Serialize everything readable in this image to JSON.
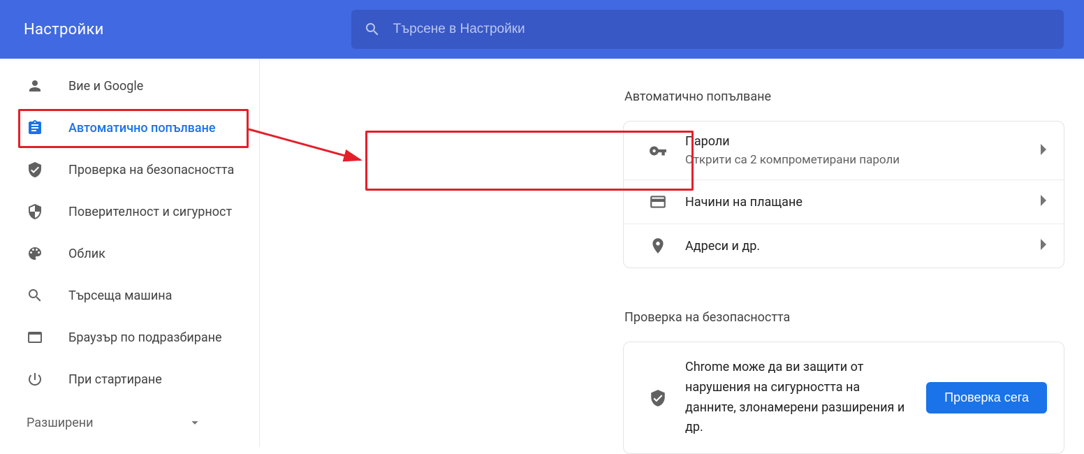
{
  "header": {
    "title": "Настройки",
    "search_placeholder": "Търсене в Настройки"
  },
  "sidebar": {
    "items": [
      {
        "label": "Вие и Google"
      },
      {
        "label": "Автоматично попълване"
      },
      {
        "label": "Проверка на безопасността"
      },
      {
        "label": "Поверителност и сигурност"
      },
      {
        "label": "Облик"
      },
      {
        "label": "Търсеща машина"
      },
      {
        "label": "Браузър по подразбиране"
      },
      {
        "label": "При стартиране"
      }
    ],
    "advanced_label": "Разширени"
  },
  "main": {
    "section1_title": "Автоматично попълване",
    "rows": [
      {
        "title": "Пароли",
        "sub": "Открити са 2 компрометирани пароли"
      },
      {
        "title": "Начини на плащане"
      },
      {
        "title": "Адреси и др."
      }
    ],
    "section2_title": "Проверка на безопасността",
    "safety_text": "Chrome може да ви защити от нарушения на сигурността на данните, злонамерени разширения и др.",
    "safety_button": "Проверка сега"
  },
  "colors": {
    "accent": "#1a73e8",
    "header_bg": "#4169e1",
    "highlight": "#e2202a"
  }
}
